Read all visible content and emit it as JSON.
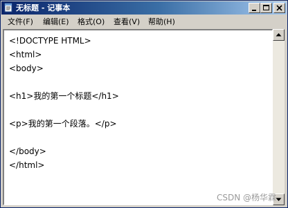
{
  "window": {
    "title": "无标题 - 记事本"
  },
  "menubar": {
    "items": [
      {
        "label": "文件(F)"
      },
      {
        "label": "编辑(E)"
      },
      {
        "label": "格式(O)"
      },
      {
        "label": "查看(V)"
      },
      {
        "label": "帮助(H)"
      }
    ]
  },
  "editor": {
    "lines": [
      "<!DOCTYPE HTML>",
      "<html>",
      "<body>",
      "",
      "<h1>我的第一个标题</h1>",
      "",
      "<p>我的第一个段落。</p>",
      "",
      "</body>",
      "</html>"
    ]
  },
  "watermark": {
    "text": "CSDN @杨华霖"
  }
}
